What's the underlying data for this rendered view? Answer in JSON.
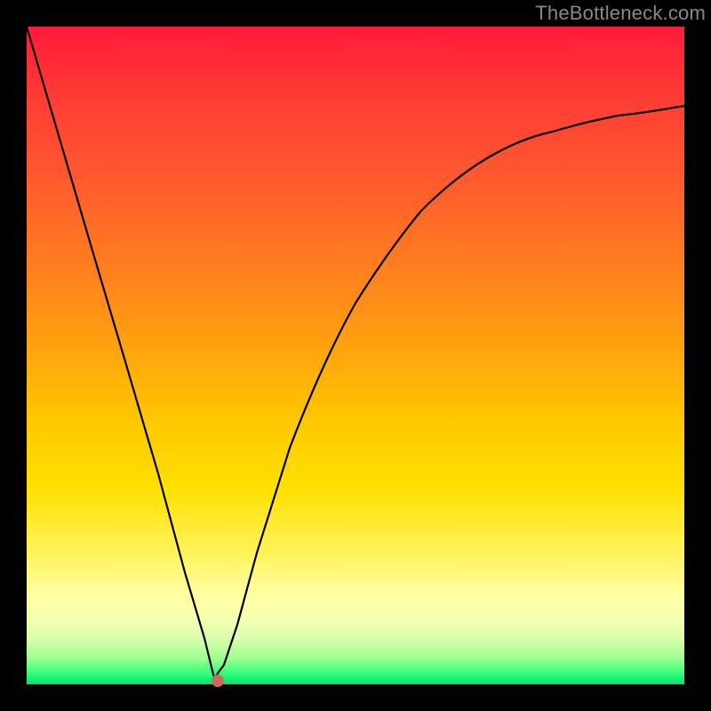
{
  "watermark": "TheBottleneck.com",
  "chart_data": {
    "type": "line",
    "title": "",
    "xlabel": "",
    "ylabel": "",
    "x_range": [
      0,
      1
    ],
    "y_range": [
      0,
      1
    ],
    "series": [
      {
        "name": "bottleneck-curve",
        "x": [
          0.0,
          0.05,
          0.1,
          0.15,
          0.2,
          0.24,
          0.27,
          0.285,
          0.3,
          0.32,
          0.35,
          0.4,
          0.45,
          0.5,
          0.55,
          0.6,
          0.65,
          0.7,
          0.75,
          0.8,
          0.85,
          0.9,
          0.95,
          1.0
        ],
        "y": [
          1.0,
          0.83,
          0.66,
          0.49,
          0.32,
          0.17,
          0.07,
          0.01,
          0.03,
          0.09,
          0.2,
          0.36,
          0.49,
          0.58,
          0.66,
          0.72,
          0.77,
          0.8,
          0.83,
          0.85,
          0.86,
          0.87,
          0.875,
          0.88
        ]
      }
    ],
    "annotations": [
      {
        "name": "marker-dot",
        "x": 0.29,
        "y": 0.005
      }
    ],
    "background_gradient": {
      "top": "#ff1a3a",
      "mid": "#ffe000",
      "bottom": "#00e66a"
    }
  }
}
